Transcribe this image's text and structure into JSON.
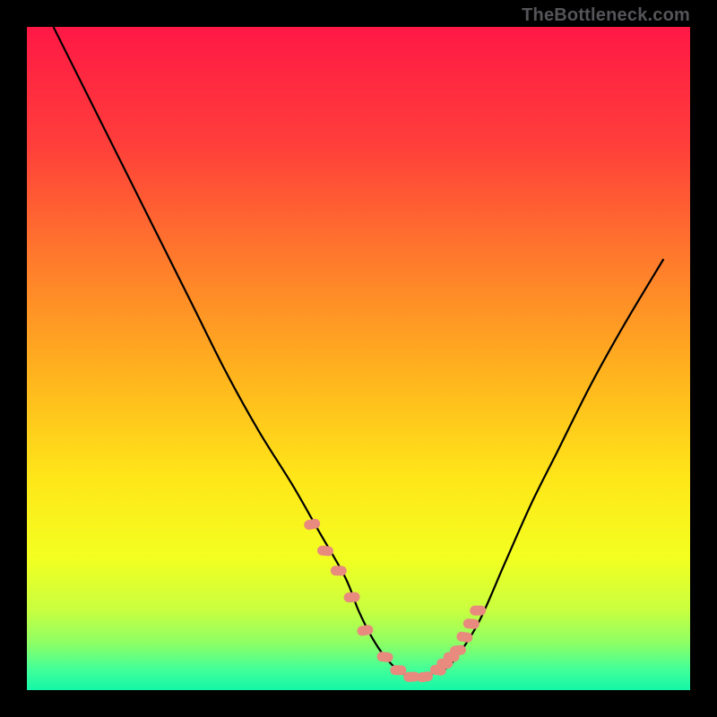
{
  "watermark": "TheBottleneck.com",
  "chart_data": {
    "type": "line",
    "title": "",
    "xlabel": "",
    "ylabel": "",
    "xlim": [
      0,
      100
    ],
    "ylim": [
      0,
      100
    ],
    "series": [
      {
        "name": "bottleneck-curve",
        "x": [
          4,
          10,
          15,
          20,
          25,
          30,
          35,
          40,
          44,
          48,
          50,
          52,
          54,
          56,
          58,
          60,
          62,
          64,
          68,
          72,
          76,
          80,
          85,
          90,
          96
        ],
        "y": [
          100,
          88,
          78,
          68,
          58,
          48,
          39,
          31,
          24,
          17,
          12,
          8,
          5,
          3,
          2,
          2,
          3,
          4,
          10,
          19,
          28,
          36,
          46,
          55,
          65
        ]
      }
    ],
    "highlight_points": {
      "name": "sample-points",
      "x": [
        43,
        45,
        47,
        49,
        51,
        54,
        56,
        58,
        60,
        62,
        63,
        64,
        65,
        66,
        67,
        68
      ],
      "y": [
        25,
        21,
        18,
        14,
        9,
        5,
        3,
        2,
        2,
        3,
        4,
        5,
        6,
        8,
        10,
        12
      ]
    },
    "gradient_stops": [
      {
        "offset": 0.0,
        "color": "#ff1846"
      },
      {
        "offset": 0.18,
        "color": "#ff3f3a"
      },
      {
        "offset": 0.35,
        "color": "#ff7a2c"
      },
      {
        "offset": 0.52,
        "color": "#ffb21e"
      },
      {
        "offset": 0.68,
        "color": "#ffe619"
      },
      {
        "offset": 0.8,
        "color": "#f3ff20"
      },
      {
        "offset": 0.88,
        "color": "#c8ff40"
      },
      {
        "offset": 0.93,
        "color": "#8cff66"
      },
      {
        "offset": 0.97,
        "color": "#40ff9a"
      },
      {
        "offset": 1.0,
        "color": "#14f7a8"
      }
    ]
  }
}
